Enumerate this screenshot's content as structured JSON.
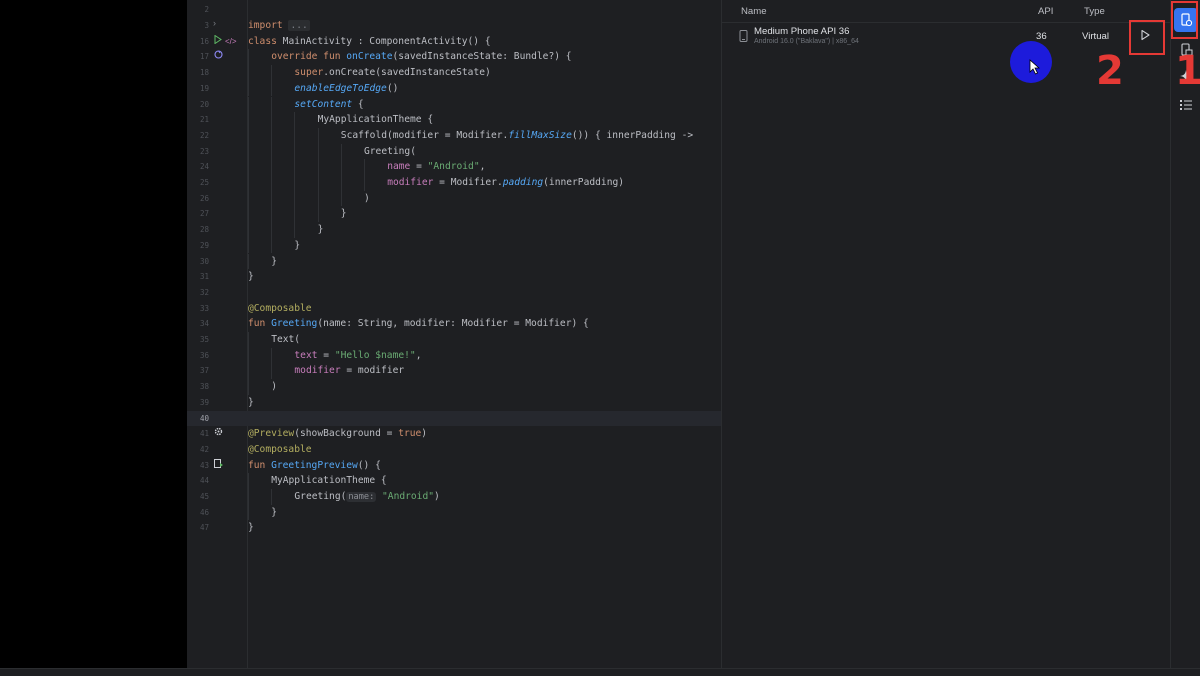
{
  "gutter": {
    "lines": [
      "2",
      "3",
      "16",
      "17",
      "18",
      "19",
      "20",
      "21",
      "22",
      "23",
      "24",
      "25",
      "26",
      "27",
      "28",
      "29",
      "30",
      "31",
      "32",
      "33",
      "34",
      "35",
      "36",
      "37",
      "38",
      "39",
      "40",
      "41",
      "42",
      "43",
      "44",
      "45",
      "46",
      "47"
    ],
    "current_index": 26
  },
  "code": {
    "import_kw": "import",
    "fold": "...",
    "l16": {
      "class_kw": "class",
      "name": "MainActivity : ComponentActivity() {"
    },
    "l17": {
      "mods": "override fun",
      "fn": "onCreate",
      "rest": "(savedInstanceState: Bundle?) {"
    },
    "l18": {
      "kw": "super",
      "rest": ".onCreate(savedInstanceState)"
    },
    "l19": {
      "fn": "enableEdgeToEdge",
      "rest": "()"
    },
    "l20": {
      "fn": "setContent",
      "rest": " {"
    },
    "l21": "MyApplicationTheme {",
    "l22": {
      "a": "Scaffold(modifier = Modifier.",
      "fn": "fillMaxSize",
      "b": "()) { innerPadding ->"
    },
    "l23": "Greeting(",
    "l24": {
      "param": "name",
      "eq": " = ",
      "str": "\"Android\"",
      "tail": ","
    },
    "l25": {
      "param": "modifier",
      "a": " = Modifier.",
      "fn": "padding",
      "b": "(innerPadding)"
    },
    "l26": ")",
    "l27": "}",
    "l28": "}",
    "l29": "}",
    "l30": "}",
    "l31": "}",
    "l33": "@Composable",
    "l34": {
      "kw": "fun",
      "fn": "Greeting",
      "rest": "(name: String, modifier: Modifier = Modifier) {"
    },
    "l35": "Text(",
    "l36": {
      "param": "text",
      "eq": " = ",
      "str": "\"Hello $name!\"",
      "tail": ","
    },
    "l37": {
      "param": "modifier",
      "rest": " = modifier"
    },
    "l38": ")",
    "l39": "}",
    "l41": {
      "ann": "@Preview",
      "rest": "(showBackground = ",
      "kw": "true",
      "end": ")"
    },
    "l42": "@Composable",
    "l43": {
      "kw": "fun",
      "fn": "GreetingPreview",
      "rest": "() {"
    },
    "l44": "MyApplicationTheme {",
    "l45": {
      "fn": "Greeting(",
      "hint": "name:",
      "str": "\"Android\"",
      "end": ")"
    },
    "l46": "}",
    "l47": "}"
  },
  "device_manager": {
    "columns": {
      "name": "Name",
      "api": "API",
      "type": "Type"
    },
    "devices": [
      {
        "name": "Medium Phone API 36",
        "subtitle": "Android 16.0 (\"Baklava\") | x86_64",
        "api": "36",
        "type": "Virtual"
      }
    ]
  },
  "annotations": {
    "label1": "1",
    "label2": "2",
    "color": "#e53935"
  },
  "colors": {
    "editor_bg": "#1e1f22",
    "accent": "#3574f0",
    "cursor": "#1e1be6"
  }
}
